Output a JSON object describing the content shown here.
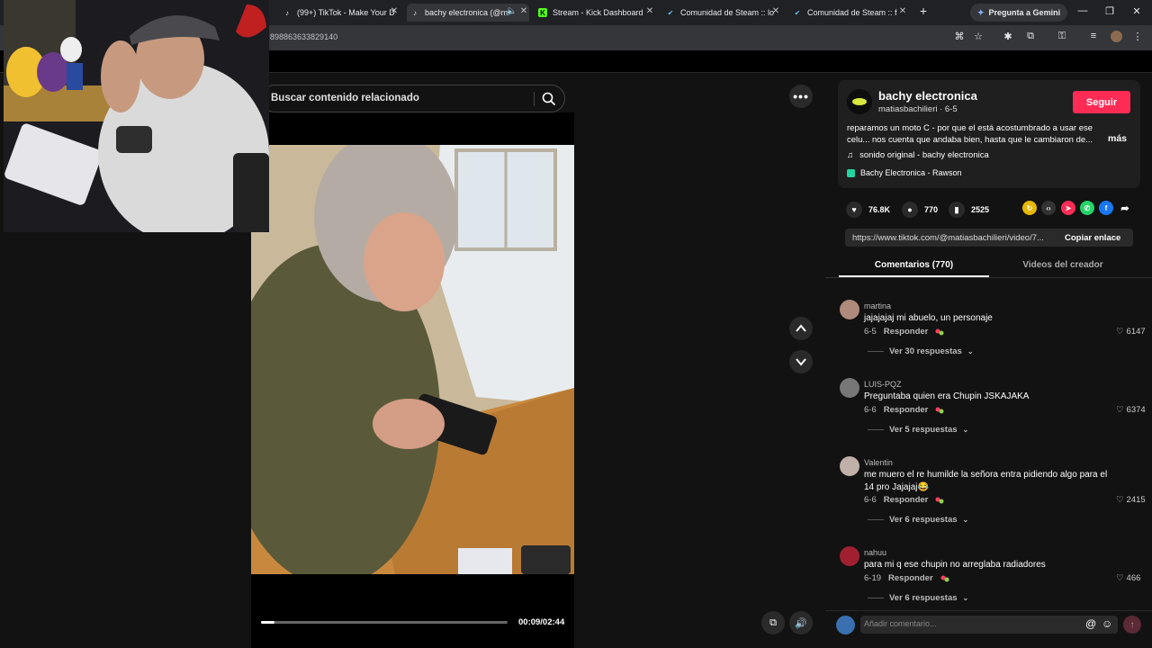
{
  "browser": {
    "tabs": [
      {
        "title": "(99+) TikTok - Make Your D",
        "icon": "tiktok-icon"
      },
      {
        "title": "bachy electronica (@m",
        "icon": "tiktok-icon"
      },
      {
        "title": "Stream - Kick Dashboard",
        "icon": "kick-icon"
      },
      {
        "title": "Comunidad de Steam :: lo",
        "icon": "steam-icon"
      },
      {
        "title": "Comunidad de Steam :: f",
        "icon": "steam-icon"
      }
    ],
    "new_tab": "+",
    "gemini_label": "Pregunta a Gemini",
    "url": "898863633829140"
  },
  "search": {
    "placeholder": "Buscar contenido relacionado"
  },
  "video": {
    "time": "00:09/02:44",
    "progress": 0.055
  },
  "creator": {
    "name": "bachy electronica",
    "handle_date": "matiasbachilieri · 6-5",
    "follow_label": "Seguir",
    "description": "reparamos un moto C - por que el está acostumbrado a usar ese celu... nos cuenta que andaba bien, hasta que le cambiaron de...",
    "more_label": "más",
    "music": "sonido original - bachy electronica",
    "location": "Bachy Electronica - Rawson"
  },
  "stats": {
    "likes": "76.8K",
    "comments": "770",
    "saves": "2525"
  },
  "link": {
    "url": "https://www.tiktok.com/@matiasbachilieri/video/7...",
    "copy_label": "Copiar enlace"
  },
  "panel_tabs": {
    "comments": "Comentarios (770)",
    "creator_videos": "Videos del creador"
  },
  "reply_label": "Responder",
  "comments": [
    {
      "user": "martina",
      "text": "jajajajaj mi abuelo, un personaje ",
      "date": "6-5",
      "likes": "6147",
      "replies": "Ver 30 respuestas",
      "avatar_color": "#b08a7a"
    },
    {
      "user": "LUIS-PQZ",
      "text": "Preguntaba quien era Chupin JSKAJAKA",
      "date": "6-6",
      "likes": "6374",
      "replies": "Ver 5 respuestas",
      "avatar_color": "#777777"
    },
    {
      "user": "Valentin",
      "text": "me muero el re humilde la señora entra pidiendo algo para el 14 pro Jajajaj😂",
      "date": "6-6",
      "likes": "2415",
      "replies": "Ver 6 respuestas",
      "avatar_color": "#c0b0a8"
    },
    {
      "user": "nahuu",
      "text": "para mi q ese chupin no arreglaba radiadores",
      "date": "6-19",
      "likes": "466",
      "replies": "Ver 6 respuestas",
      "avatar_color": "#a02030"
    }
  ],
  "comment_input": {
    "placeholder": "Añadir comentario..."
  },
  "colors": {
    "accent": "#fe2c55",
    "background": "#121212",
    "card": "#1f1f1f"
  }
}
